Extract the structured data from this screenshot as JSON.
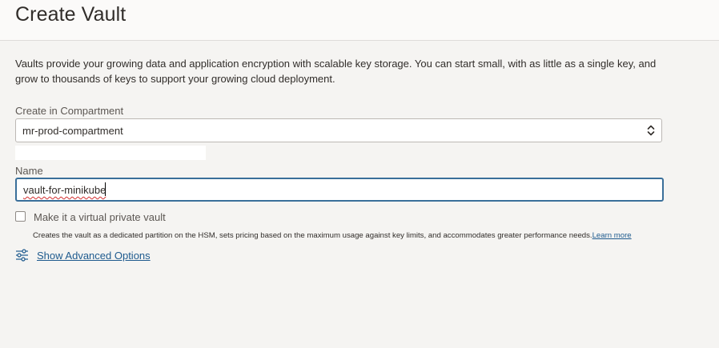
{
  "header": {
    "title": "Create Vault"
  },
  "description": "Vaults provide your growing data and application encryption with scalable key storage. You can start small, with as little as a single key, and grow to thousands of keys to support your growing cloud deployment.",
  "compartment": {
    "label": "Create in Compartment",
    "selected": "mr-prod-compartment",
    "icon": "chevron-up-down-icon"
  },
  "name_field": {
    "label": "Name",
    "value": "vault-for-minikube"
  },
  "virtual_private_vault": {
    "label": "Make it a virtual private vault",
    "checked": false,
    "helper": "Creates the vault as a dedicated partition on the HSM, sets pricing based on the maximum usage against key limits, and accommodates greater performance needs.",
    "learn_more": "Learn more"
  },
  "advanced": {
    "label": "Show Advanced Options",
    "icon": "sliders-icon"
  },
  "colors": {
    "link": "#1e5a8e",
    "focus_border": "#3a6f9a",
    "background": "#f5f4f2"
  }
}
